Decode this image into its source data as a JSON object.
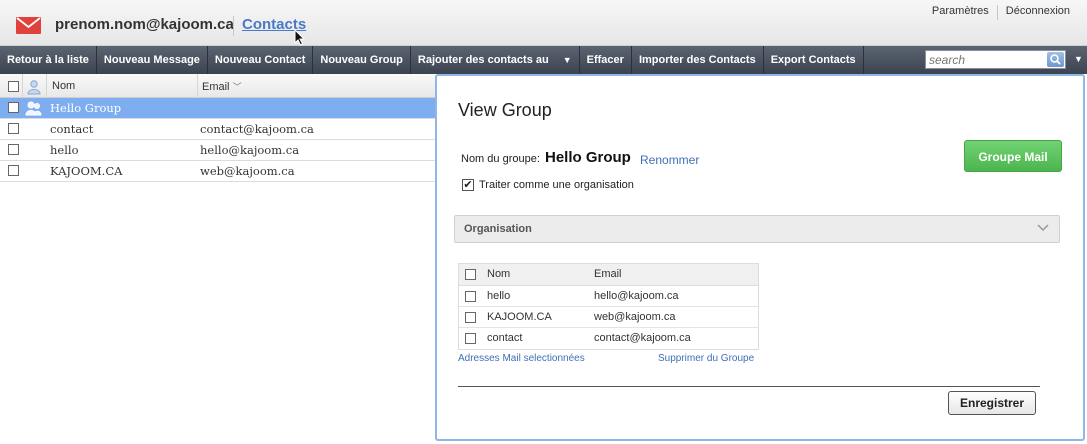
{
  "header": {
    "user_email": "prenom.nom@kajoom.ca",
    "section_link": "Contacts",
    "settings_link": "Paramètres",
    "logout_link": "Déconnexion"
  },
  "toolbar": {
    "items": [
      {
        "label": "Retour à la liste"
      },
      {
        "label": "Nouveau Message"
      },
      {
        "label": "Nouveau Contact"
      },
      {
        "label": "Nouveau Group"
      },
      {
        "label": "Rajouter des contacts au"
      },
      {
        "label": "Effacer"
      },
      {
        "label": "Importer des Contacts"
      },
      {
        "label": "Export Contacts"
      }
    ],
    "search_placeholder": "search"
  },
  "contact_list": {
    "columns": {
      "name": "Nom",
      "email": "Email"
    },
    "rows": [
      {
        "name": "Hello Group",
        "email": "",
        "selected": true
      },
      {
        "name": "contact",
        "email": "contact@kajoom.ca"
      },
      {
        "name": "hello",
        "email": "hello@kajoom.ca"
      },
      {
        "name": "KAJOOM.CA",
        "email": "web@kajoom.ca"
      }
    ]
  },
  "group_panel": {
    "title": "View Group",
    "group_name_label": "Nom du groupe:",
    "group_name": "Hello Group",
    "rename_link": "Renommer",
    "org_checkbox_label": "Traiter comme une organisation",
    "org_checked": true,
    "mail_button": "Groupe Mail",
    "section_title": "Organisation",
    "members": {
      "columns": {
        "name": "Nom",
        "email": "Email"
      },
      "rows": [
        {
          "name": "hello",
          "email": "hello@kajoom.ca"
        },
        {
          "name": "KAJOOM.CA",
          "email": "web@kajoom.ca"
        },
        {
          "name": "contact",
          "email": "contact@kajoom.ca"
        }
      ]
    },
    "selected_mail_link": "Adresses Mail selectionnées",
    "remove_link": "Supprimer du Groupe",
    "save_button": "Enregistrer"
  },
  "colors": {
    "accent": "#4a79c8",
    "selected_row": "#7eaef0",
    "toolbar": "#4a5260",
    "mail_button": "#5cc05f"
  }
}
